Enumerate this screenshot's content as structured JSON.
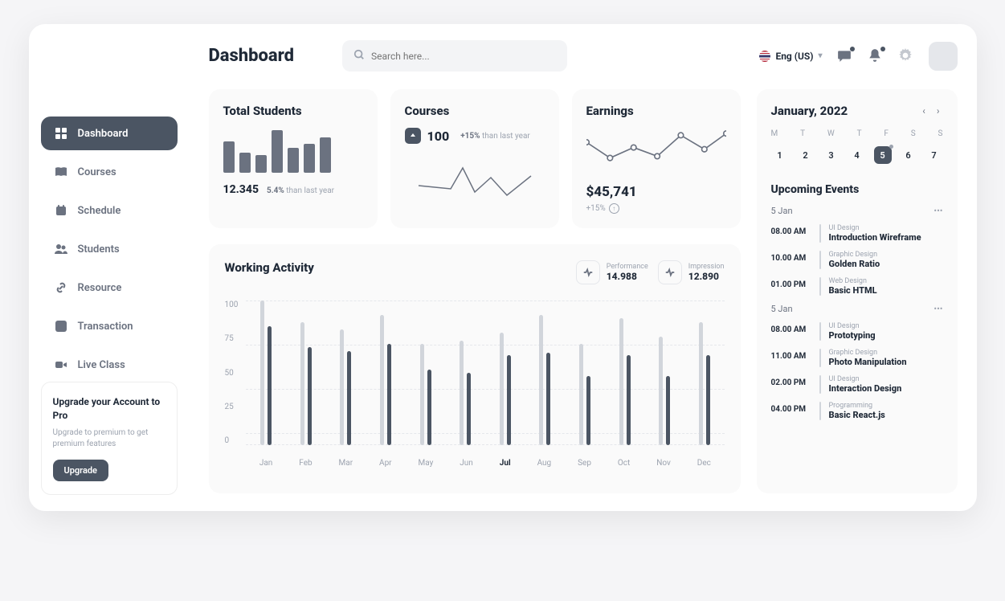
{
  "header": {
    "title": "Dashboard",
    "search_placeholder": "Search here...",
    "language": "Eng (US)"
  },
  "sidebar": {
    "items": [
      {
        "label": "Dashboard",
        "icon": "grid-icon",
        "active": true
      },
      {
        "label": "Courses",
        "icon": "book-icon",
        "active": false
      },
      {
        "label": "Schedule",
        "icon": "calendar-icon",
        "active": false
      },
      {
        "label": "Students",
        "icon": "users-icon",
        "active": false
      },
      {
        "label": "Resource",
        "icon": "link-icon",
        "active": false
      },
      {
        "label": "Transaction",
        "icon": "swap-icon",
        "active": false
      },
      {
        "label": "Live Class",
        "icon": "video-icon",
        "active": false
      }
    ],
    "upgrade": {
      "title": "Upgrade your Account to Pro",
      "desc": "Upgrade to premium to get premium features",
      "button": "Upgrade"
    }
  },
  "stats": {
    "students": {
      "title": "Total Students",
      "value": "12.345",
      "delta": "5.4%",
      "delta_suffix": " than last year"
    },
    "courses": {
      "title": "Courses",
      "value": "100",
      "delta": "+15%",
      "delta_suffix": " than last year"
    },
    "earnings": {
      "title": "Earnings",
      "value": "$45,741",
      "delta": "+15%"
    }
  },
  "activity": {
    "title": "Working Activity",
    "performance": {
      "label": "Performance",
      "value": "14.988"
    },
    "impression": {
      "label": "Impression",
      "value": "12.890"
    },
    "y_ticks": [
      "100",
      "75",
      "50",
      "25",
      "0"
    ],
    "months": [
      "Jan",
      "Feb",
      "Mar",
      "Apr",
      "May",
      "Jun",
      "Jul",
      "Aug",
      "Sep",
      "Oct",
      "Nov",
      "Dec"
    ],
    "current_month": "Jul"
  },
  "calendar": {
    "title": "January, 2022",
    "weekdays": [
      "M",
      "T",
      "W",
      "T",
      "F",
      "S",
      "S"
    ],
    "dates": [
      "1",
      "2",
      "3",
      "4",
      "5",
      "6",
      "7"
    ],
    "selected": "5"
  },
  "events": {
    "title": "Upcoming Events",
    "days": [
      {
        "date": "5 Jan",
        "items": [
          {
            "time": "08.00 AM",
            "category": "UI Design",
            "name": "Introduction Wireframe"
          },
          {
            "time": "10.00 AM",
            "category": "Graphic Design",
            "name": "Golden Ratio"
          },
          {
            "time": "01.00 PM",
            "category": "Web Design",
            "name": "Basic HTML"
          }
        ]
      },
      {
        "date": "5 Jan",
        "items": [
          {
            "time": "08.00 AM",
            "category": "UI Design",
            "name": "Prototyping"
          },
          {
            "time": "11.00 AM",
            "category": "Graphic Design",
            "name": "Photo Manipulation"
          },
          {
            "time": "02.00 PM",
            "category": "UI Design",
            "name": "Interaction Design"
          },
          {
            "time": "04.00 PM",
            "category": "Programming",
            "name": "Basic React.js"
          }
        ]
      }
    ]
  },
  "chart_data": [
    {
      "type": "bar",
      "title": "Total Students",
      "categories": [
        "b1",
        "b2",
        "b3",
        "b4",
        "b5",
        "b6",
        "b7"
      ],
      "values": [
        70,
        45,
        40,
        95,
        55,
        65,
        78
      ]
    },
    {
      "type": "line",
      "title": "Courses",
      "x": [
        0,
        1,
        2,
        3,
        4,
        5,
        6,
        7
      ],
      "values": [
        30,
        28,
        26,
        50,
        20,
        38,
        18,
        42
      ]
    },
    {
      "type": "line",
      "title": "Earnings",
      "x": [
        0,
        1,
        2,
        3,
        4,
        5,
        6
      ],
      "values": [
        42,
        30,
        38,
        28,
        48,
        36,
        50
      ]
    },
    {
      "type": "bar",
      "title": "Working Activity",
      "categories": [
        "Jan",
        "Feb",
        "Mar",
        "Apr",
        "May",
        "Jun",
        "Jul",
        "Aug",
        "Sep",
        "Oct",
        "Nov",
        "Dec"
      ],
      "series": [
        {
          "name": "background",
          "values": [
            100,
            85,
            80,
            90,
            70,
            72,
            78,
            90,
            70,
            88,
            75,
            85
          ]
        },
        {
          "name": "foreground",
          "values": [
            82,
            68,
            65,
            70,
            52,
            50,
            62,
            64,
            48,
            62,
            48,
            62
          ]
        }
      ],
      "ylim": [
        0,
        100
      ],
      "y_ticks": [
        0,
        25,
        50,
        75,
        100
      ]
    }
  ]
}
